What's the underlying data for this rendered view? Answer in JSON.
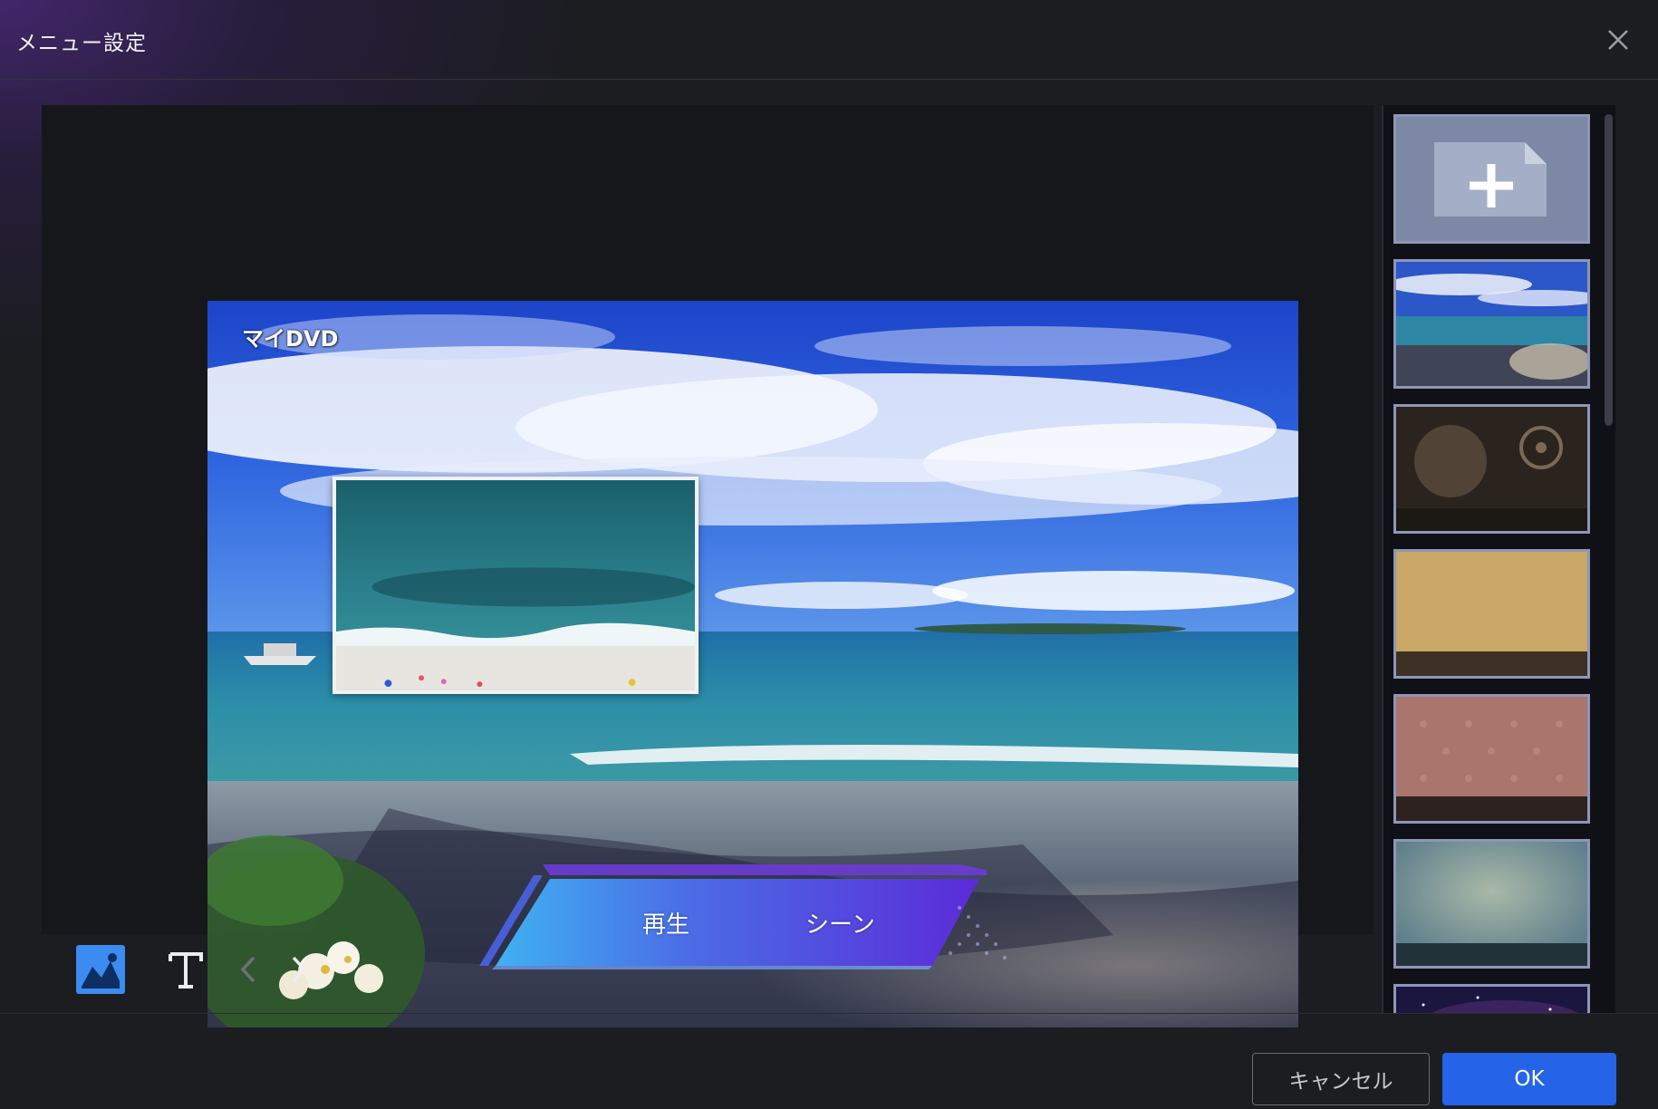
{
  "window": {
    "title": "メニュー設定",
    "close_icon": "close-icon"
  },
  "preview": {
    "menu_title": "マイDVD",
    "buttons": {
      "play": "再生",
      "scenes": "シーン"
    }
  },
  "toolbar": {
    "tools": [
      {
        "name": "background-image-icon",
        "active": true
      },
      {
        "name": "text-tool-icon",
        "active": false
      },
      {
        "name": "chevron-left-icon",
        "active": false
      },
      {
        "name": "chevron-right-icon",
        "active": false
      }
    ]
  },
  "template_panel": {
    "tiles": [
      {
        "name": "add-template-tile"
      },
      {
        "name": "template-beach"
      },
      {
        "name": "template-film"
      },
      {
        "name": "template-gold"
      },
      {
        "name": "template-pink"
      },
      {
        "name": "template-teal"
      },
      {
        "name": "template-galaxy"
      }
    ]
  },
  "footer": {
    "cancel_label": "キャンセル",
    "ok_label": "OK"
  },
  "colors": {
    "accent": "#2563e8",
    "background": "#1c1d21",
    "tile_border": "#8e96b8"
  }
}
